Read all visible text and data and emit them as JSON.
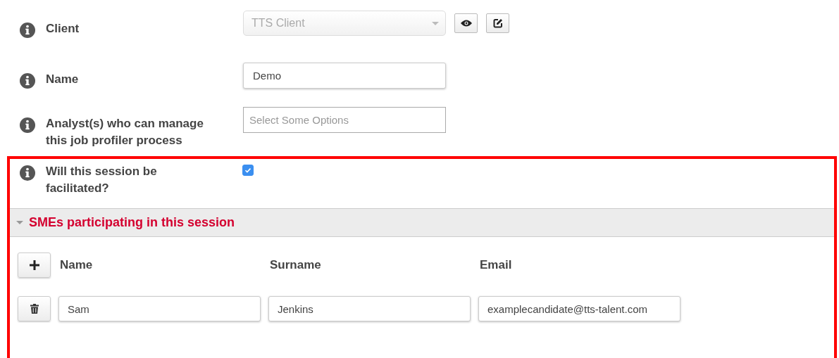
{
  "fields": [
    {
      "kind": "select",
      "label": "Client",
      "value": "TTS Client",
      "disabled": true
    },
    {
      "kind": "text",
      "label": "Name",
      "value": "Demo"
    },
    {
      "kind": "multiselect",
      "label": "Analyst(s) who can manage this job profiler process",
      "placeholder": "Select Some Options"
    }
  ],
  "session": {
    "highlighted": true,
    "label": "Will this session be facilitated?",
    "checked": true,
    "section": {
      "title": "SMEs participating in this session",
      "expanded": true,
      "columns": [
        "Name",
        "Surname",
        "Email"
      ],
      "rows": [
        [
          "Sam",
          "Jenkins",
          "examplecandidate@tts-talent.com"
        ]
      ]
    }
  }
}
